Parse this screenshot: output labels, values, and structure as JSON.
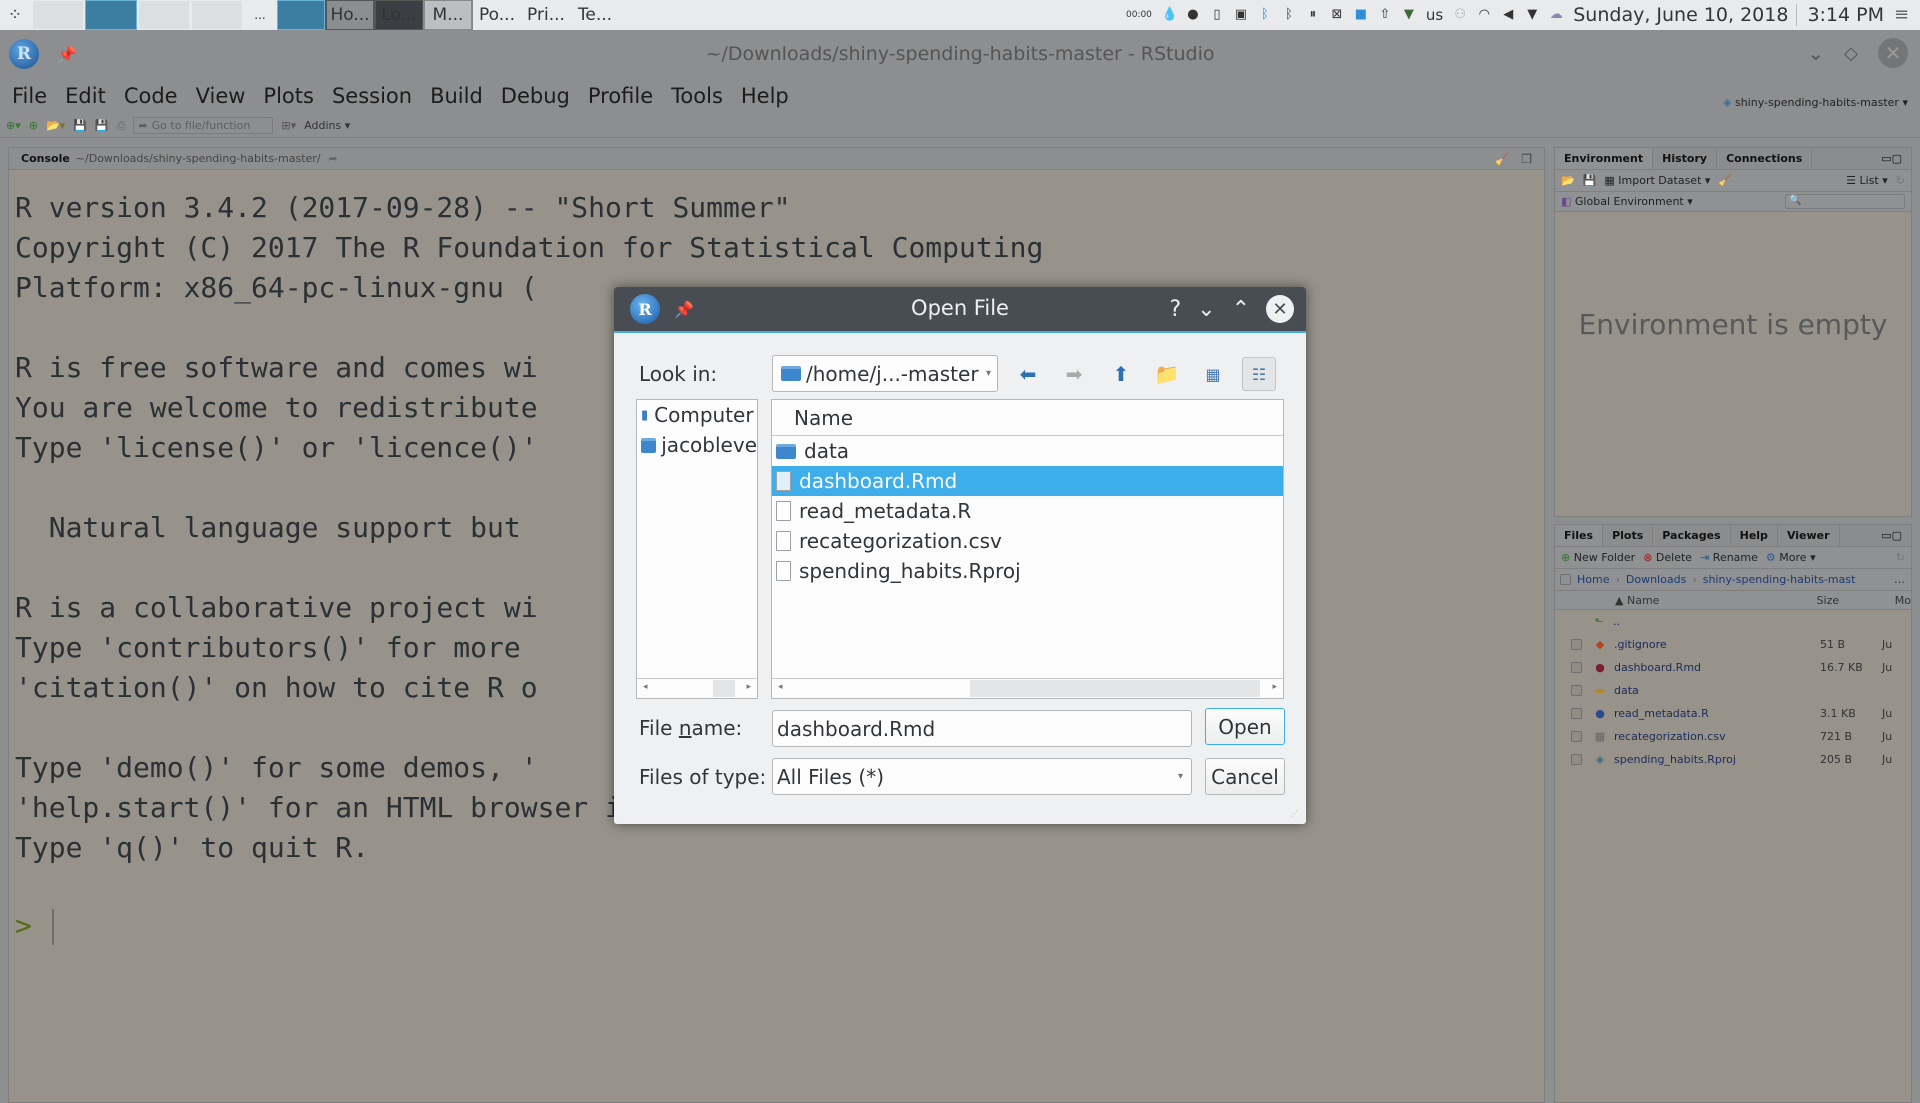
{
  "taskbar": {
    "tasks": [
      "Ho...",
      "Lo...",
      "M...",
      "Po...",
      "Pri...",
      "Te..."
    ],
    "overflow_label": "...",
    "tray": {
      "timer": "00:00",
      "keyboard_layout": "us",
      "date": "Sunday, June 10, 2018",
      "time": "3:14 PM"
    }
  },
  "window": {
    "title": "~/Downloads/shiny-spending-habits-master - RStudio",
    "menu": [
      "File",
      "Edit",
      "Code",
      "View",
      "Plots",
      "Session",
      "Build",
      "Debug",
      "Profile",
      "Tools",
      "Help"
    ],
    "toolbar": {
      "goto_placeholder": "Go to file/function",
      "addins_label": "Addins",
      "project_label": "shiny-spending-habits-master"
    }
  },
  "console": {
    "tab_label": "Console",
    "path": "~/Downloads/shiny-spending-habits-master/",
    "lines": [
      "R version 3.4.2 (2017-09-28) -- \"Short Summer\"",
      "Copyright (C) 2017 The R Foundation for Statistical Computing",
      "Platform: x86_64-pc-linux-gnu (",
      "",
      "R is free software and comes wi",
      "You are welcome to redistribute",
      "Type 'license()' or 'licence()'",
      "",
      "  Natural language support but",
      "",
      "R is a collaborative project wi",
      "Type 'contributors()' for more",
      "'citation()' on how to cite R o",
      "",
      "Type 'demo()' for some demos, '",
      "'help.start()' for an HTML browser interface to help.",
      "Type 'q()' to quit R.",
      ""
    ],
    "prompt": ">"
  },
  "environment_pane": {
    "tabs": [
      "Environment",
      "History",
      "Connections"
    ],
    "import_label": "Import Dataset",
    "list_label": "List",
    "scope_label": "Global Environment",
    "empty_message": "Environment is empty"
  },
  "files_pane": {
    "tabs": [
      "Files",
      "Plots",
      "Packages",
      "Help",
      "Viewer"
    ],
    "actions": [
      "New Folder",
      "Delete",
      "Rename",
      "More"
    ],
    "breadcrumb": [
      "Home",
      "Downloads",
      "shiny-spending-habits-mast"
    ],
    "columns": [
      "Name",
      "Size",
      "Mo"
    ],
    "up_label": "..",
    "files": [
      {
        "name": ".gitignore",
        "size": "51 B",
        "modified": "Ju",
        "icon": "git-icon"
      },
      {
        "name": "dashboard.Rmd",
        "size": "16.7 KB",
        "modified": "Ju",
        "icon": "rmd-icon"
      },
      {
        "name": "data",
        "size": "",
        "modified": "",
        "icon": "folder-icon"
      },
      {
        "name": "read_metadata.R",
        "size": "3.1 KB",
        "modified": "Ju",
        "icon": "r-script-icon"
      },
      {
        "name": "recategorization.csv",
        "size": "721 B",
        "modified": "Ju",
        "icon": "csv-icon"
      },
      {
        "name": "spending_habits.Rproj",
        "size": "205 B",
        "modified": "Ju",
        "icon": "rproj-icon"
      }
    ]
  },
  "dialog": {
    "title": "Open File",
    "look_in_label": "Look in:",
    "look_in_value": "/home/j...-master",
    "places": [
      "Computer",
      "jacobleve"
    ],
    "column_header": "Name",
    "items": [
      {
        "name": "data",
        "type": "folder",
        "selected": false
      },
      {
        "name": "dashboard.Rmd",
        "type": "file",
        "selected": true
      },
      {
        "name": "read_metadata.R",
        "type": "file",
        "selected": false
      },
      {
        "name": "recategorization.csv",
        "type": "file",
        "selected": false
      },
      {
        "name": "spending_habits.Rproj",
        "type": "file",
        "selected": false
      }
    ],
    "file_name_label": "File name:",
    "file_name_value": "dashboard.Rmd",
    "file_type_label": "Files of type:",
    "file_type_value": "All Files (*)",
    "open_label": "Open",
    "cancel_label": "Cancel"
  }
}
